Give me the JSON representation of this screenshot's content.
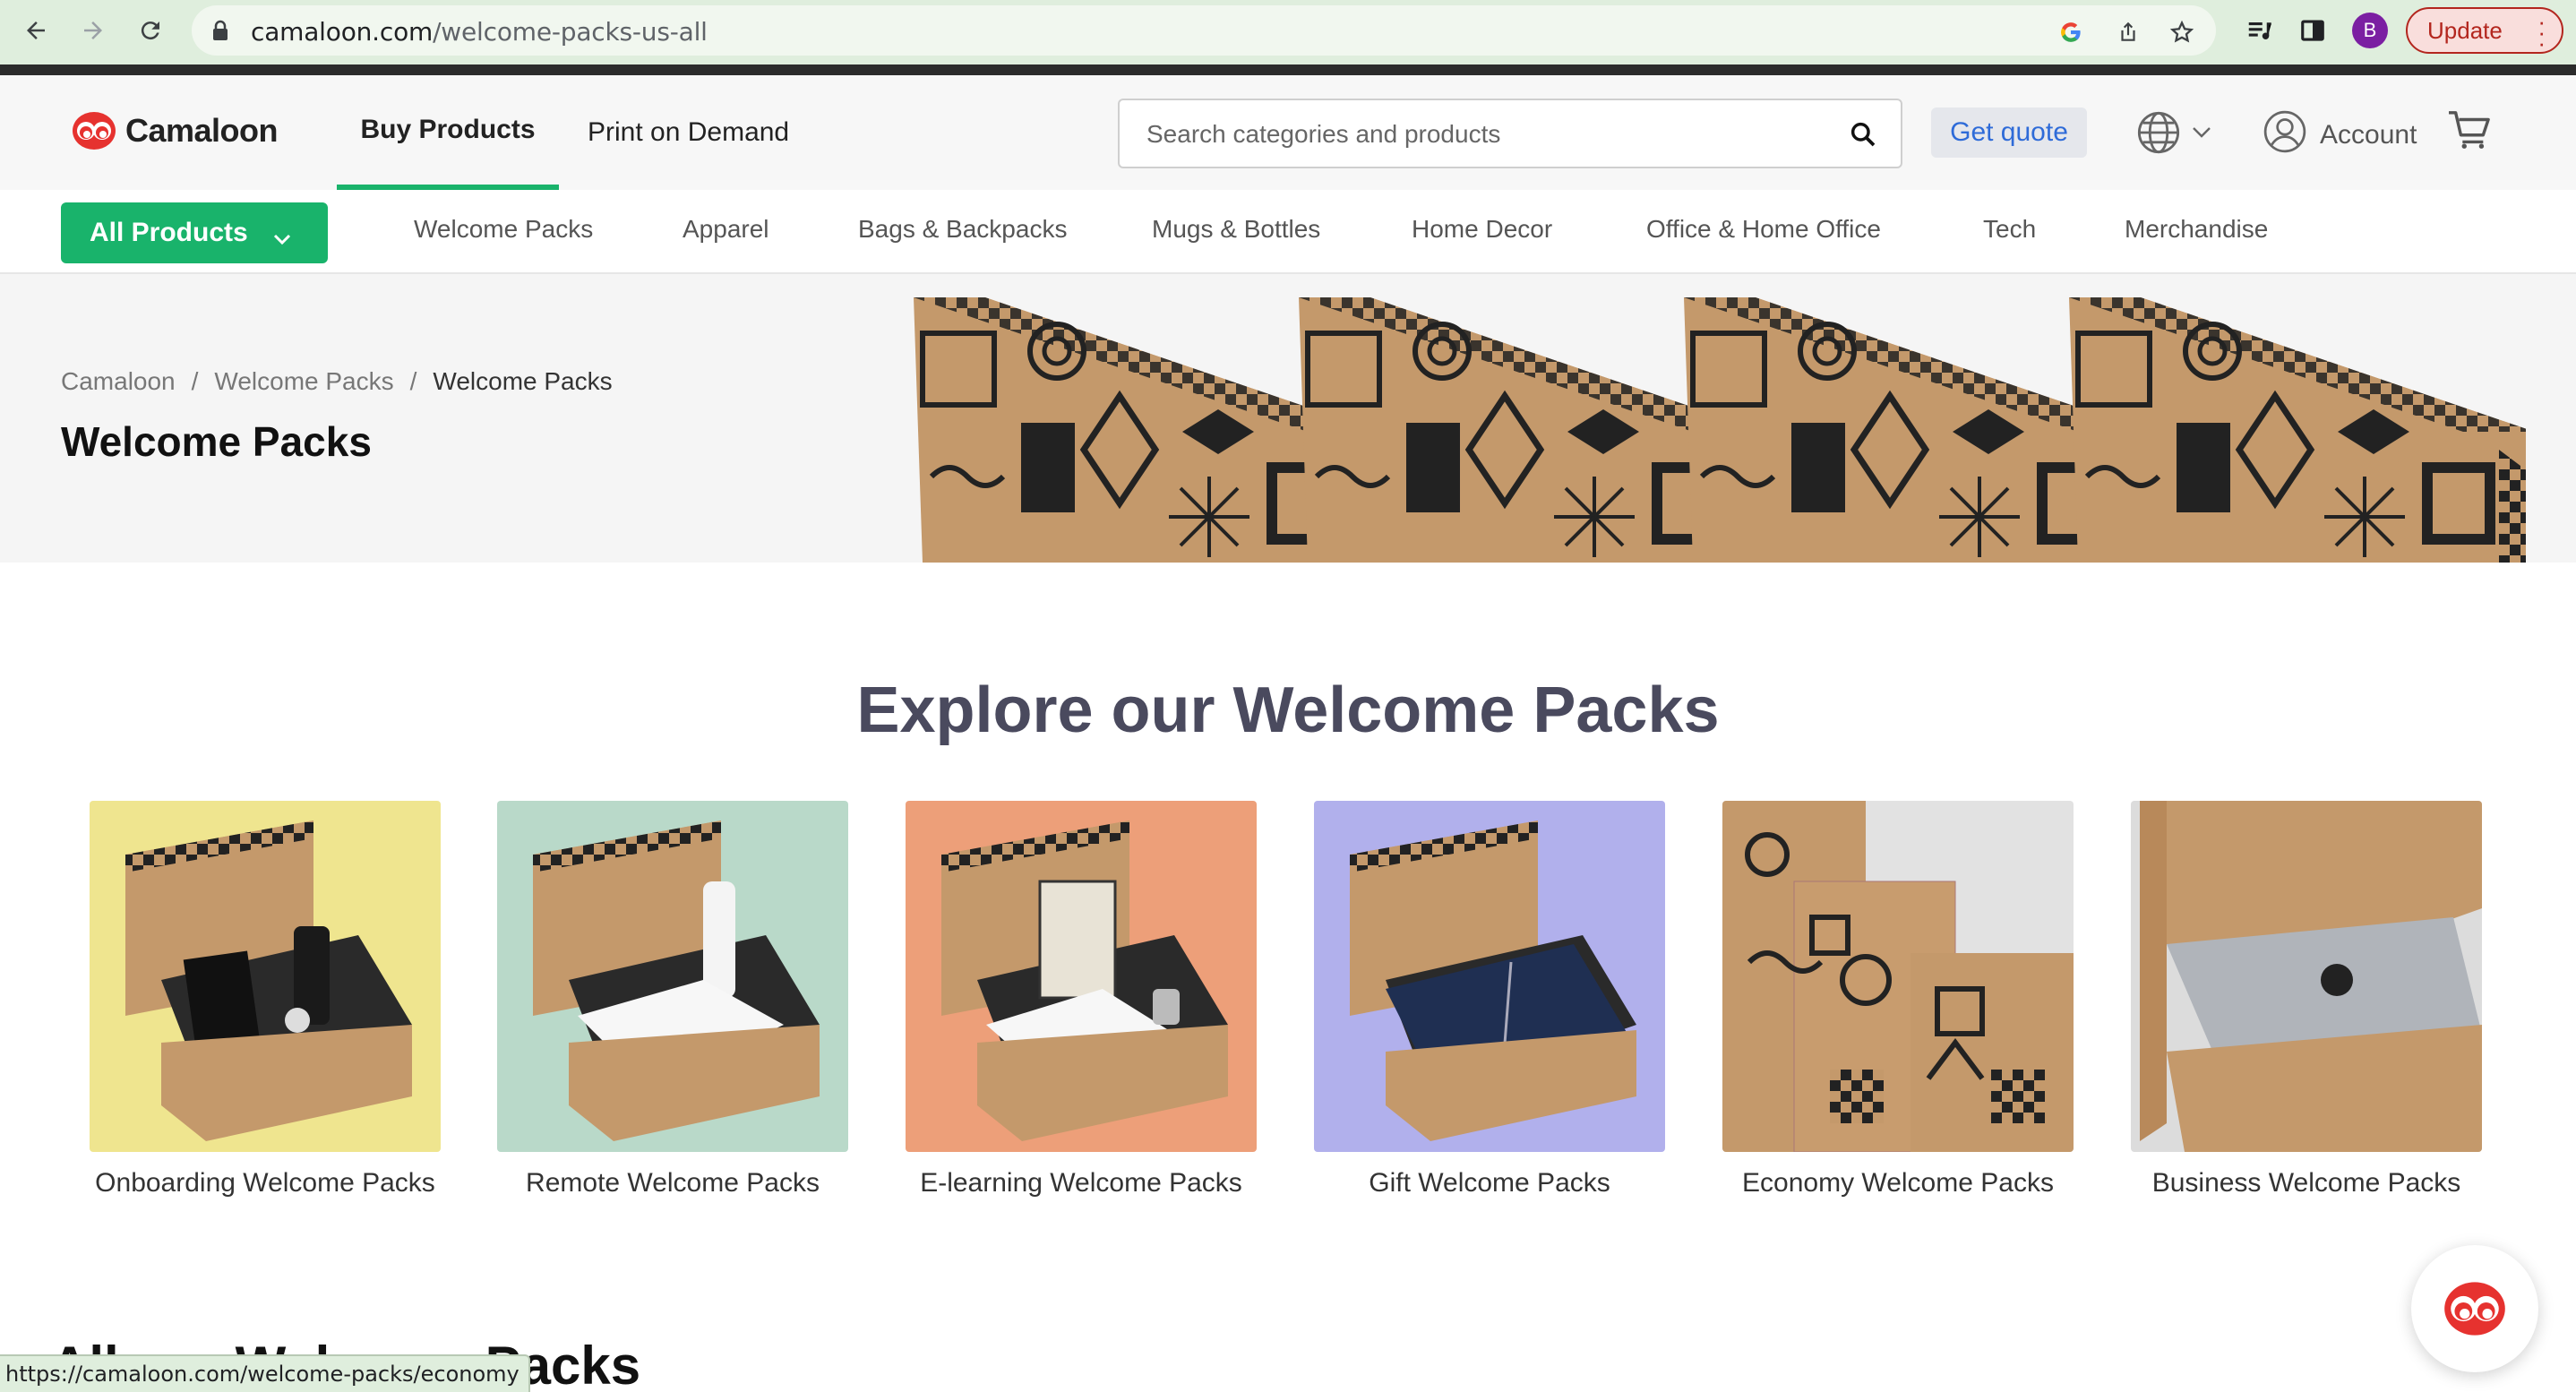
{
  "browser": {
    "url_domain": "camaloon.com",
    "url_path": "/welcome-packs-us-all",
    "profile_initial": "B",
    "update_label": "Update"
  },
  "header": {
    "brand": "Camaloon",
    "nav": [
      "Buy Products",
      "Print on Demand"
    ],
    "search_placeholder": "Search categories and products",
    "quote_label": "Get quote",
    "account_label": "Account"
  },
  "categories": {
    "all_label": "All Products",
    "items": [
      "Welcome Packs",
      "Apparel",
      "Bags & Backpacks",
      "Mugs & Bottles",
      "Home Decor",
      "Office & Home Office",
      "Tech",
      "Merchandise"
    ]
  },
  "hero": {
    "breadcrumb": [
      "Camaloon",
      "Welcome Packs",
      "Welcome Packs"
    ],
    "title": "Welcome Packs"
  },
  "explore": {
    "title": "Explore our Welcome Packs",
    "packs": [
      {
        "label": "Onboarding Welcome Packs",
        "bg": "#efe58f"
      },
      {
        "label": "Remote Welcome Packs",
        "bg": "#b9d9c9"
      },
      {
        "label": "E-learning Welcome Packs",
        "bg": "#ed9f79"
      },
      {
        "label": "Gift Welcome Packs",
        "bg": "#b1b0ec"
      },
      {
        "label": "Economy Welcome Packs",
        "bg": "#e2e2e2"
      },
      {
        "label": "Business Welcome Packs",
        "bg": "#dcdcdc"
      }
    ]
  },
  "all_packs_title": "All our Welcome Packs",
  "status_url": "https://camaloon.com/welcome-packs/economy",
  "colors": {
    "brand_green": "#19b36b",
    "brand_red": "#e6322f",
    "heading": "#4a4a5e"
  }
}
